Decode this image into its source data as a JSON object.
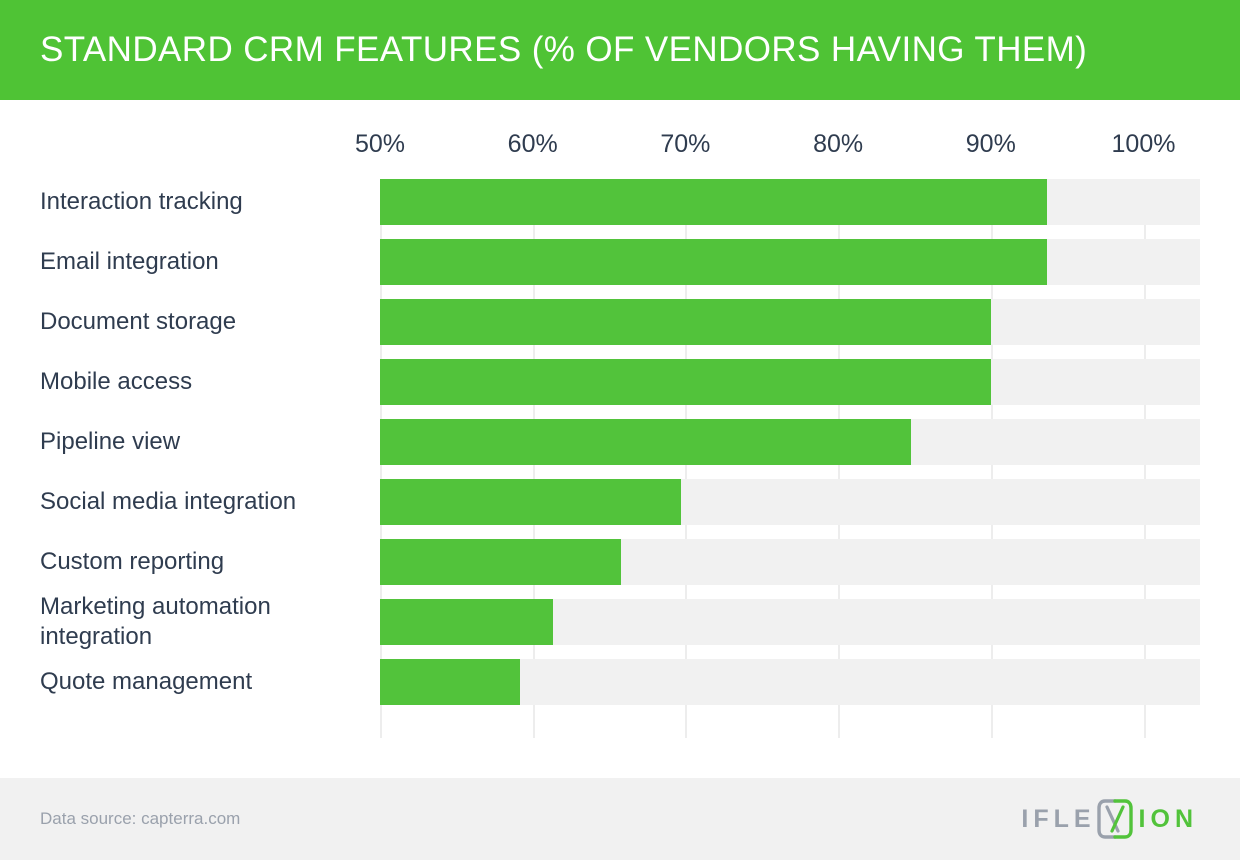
{
  "header": {
    "title": "STANDARD CRM FEATURES (% OF VENDORS HAVING THEM)",
    "background_color": "#4FC335",
    "text_color": "#FFFFFF"
  },
  "footer": {
    "source_text": "Data source: capterra.com",
    "background_color": "#F1F1F1",
    "source_text_color": "#9AA1AC",
    "logo": {
      "text_left": "IFLE",
      "text_right": "ION",
      "mark_name": "iflexion-x-mark",
      "left_color": "#9AA1AC",
      "right_color": "#52C33B"
    }
  },
  "chart_data": {
    "type": "bar",
    "orientation": "horizontal",
    "title": "STANDARD CRM FEATURES (% OF VENDORS HAVING THEM)",
    "xlabel": "",
    "ylabel": "",
    "xlim": [
      50,
      103.7
    ],
    "tick_labels": [
      "50%",
      "60%",
      "70%",
      "80%",
      "90%",
      "100%"
    ],
    "ticks": [
      50,
      60,
      70,
      80,
      90,
      100
    ],
    "grid": true,
    "legend": false,
    "bar_color": "#52C33B",
    "track_color": "#F1F1F1",
    "gridline_color": "#EDEDED",
    "label_color": "#2F3C4F",
    "categories": [
      "Interaction tracking",
      "Email integration",
      "Document storage",
      "Mobile access",
      "Pipeline view",
      "Social media integration",
      "Custom reporting",
      "Marketing automation integration",
      "Quote management"
    ],
    "values": [
      93.7,
      93.7,
      90.0,
      90.0,
      84.8,
      69.7,
      65.8,
      61.3,
      59.2
    ]
  }
}
